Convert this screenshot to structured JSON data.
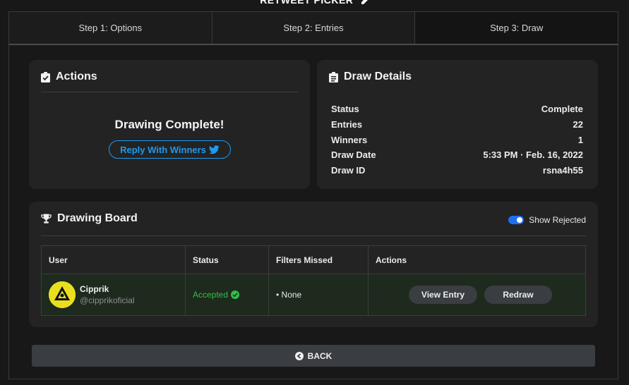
{
  "header": {
    "title": "RETWEET PICKER",
    "icon": "edit-icon"
  },
  "steps": [
    {
      "label": "Step 1: Options"
    },
    {
      "label": "Step 2: Entries"
    },
    {
      "label": "Step 3: Draw",
      "active": true
    }
  ],
  "actions": {
    "title": "Actions",
    "icon": "clipboard-check-icon",
    "message": "Drawing Complete!",
    "reply_button": "Reply With Winners",
    "reply_icon": "twitter-icon"
  },
  "details": {
    "title": "Draw Details",
    "icon": "clipboard-list-icon",
    "rows": [
      {
        "label": "Status",
        "value": "Complete"
      },
      {
        "label": "Entries",
        "value": "22"
      },
      {
        "label": "Winners",
        "value": "1"
      },
      {
        "label": "Draw Date",
        "value": "5:33 PM · Feb. 16, 2022"
      },
      {
        "label": "Draw ID",
        "value": "rsna4h55"
      }
    ]
  },
  "board": {
    "title": "Drawing Board",
    "icon": "trophy-icon",
    "toggle_label": "Show Rejected",
    "toggle_on": true,
    "columns": [
      "User",
      "Status",
      "Filters Missed",
      "Actions"
    ],
    "rows": [
      {
        "name": "Cipprik",
        "handle": "@cipprikoficial",
        "status": "Accepted",
        "filters": "• None",
        "view_label": "View Entry",
        "redraw_label": "Redraw"
      }
    ]
  },
  "back": {
    "label": "BACK",
    "icon": "arrow-left-circle-icon"
  },
  "colors": {
    "accent": "#1d9bf0",
    "accepted": "#2fbf4b",
    "card": "#232323",
    "background": "#181818"
  }
}
